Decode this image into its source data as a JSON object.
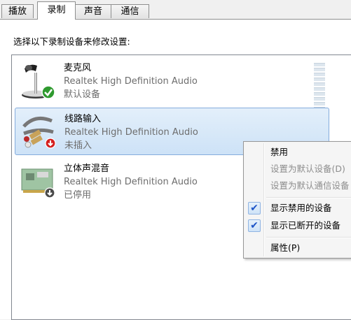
{
  "tabs": [
    "播放",
    "录制",
    "声音",
    "通信"
  ],
  "instruction": "选择以下录制设备来修改设置:",
  "devices": [
    {
      "name": "麦克风",
      "driver": "Realtek High Definition Audio",
      "status": "默认设备",
      "icon": "microphone-icon",
      "badge": "default-checkmark-icon"
    },
    {
      "name": "线路输入",
      "driver": "Realtek High Definition Audio",
      "status": "未插入",
      "icon": "line-in-cable-icon",
      "badge": "unplugged-arrow-icon"
    },
    {
      "name": "立体声混音",
      "driver": "Realtek High Definition Audio",
      "status": "已停用",
      "icon": "sound-card-icon",
      "badge": "disabled-arrow-icon"
    }
  ],
  "context_menu": {
    "items": [
      {
        "label": "禁用",
        "enabled": true,
        "checked": false
      },
      {
        "label": "设置为默认设备(D)",
        "enabled": false,
        "checked": false
      },
      {
        "label": "设置为默认通信设备",
        "enabled": false,
        "checked": false
      },
      {
        "label": "显示禁用的设备",
        "enabled": true,
        "checked": true
      },
      {
        "label": "显示已断开的设备",
        "enabled": true,
        "checked": true
      },
      {
        "label": "属性(P)",
        "enabled": true,
        "checked": false
      }
    ]
  },
  "colors": {
    "selection": "#cde2f7",
    "check": "#1e55c7",
    "ok_badge": "#2f9a2f",
    "unplug_badge": "#d42020"
  }
}
